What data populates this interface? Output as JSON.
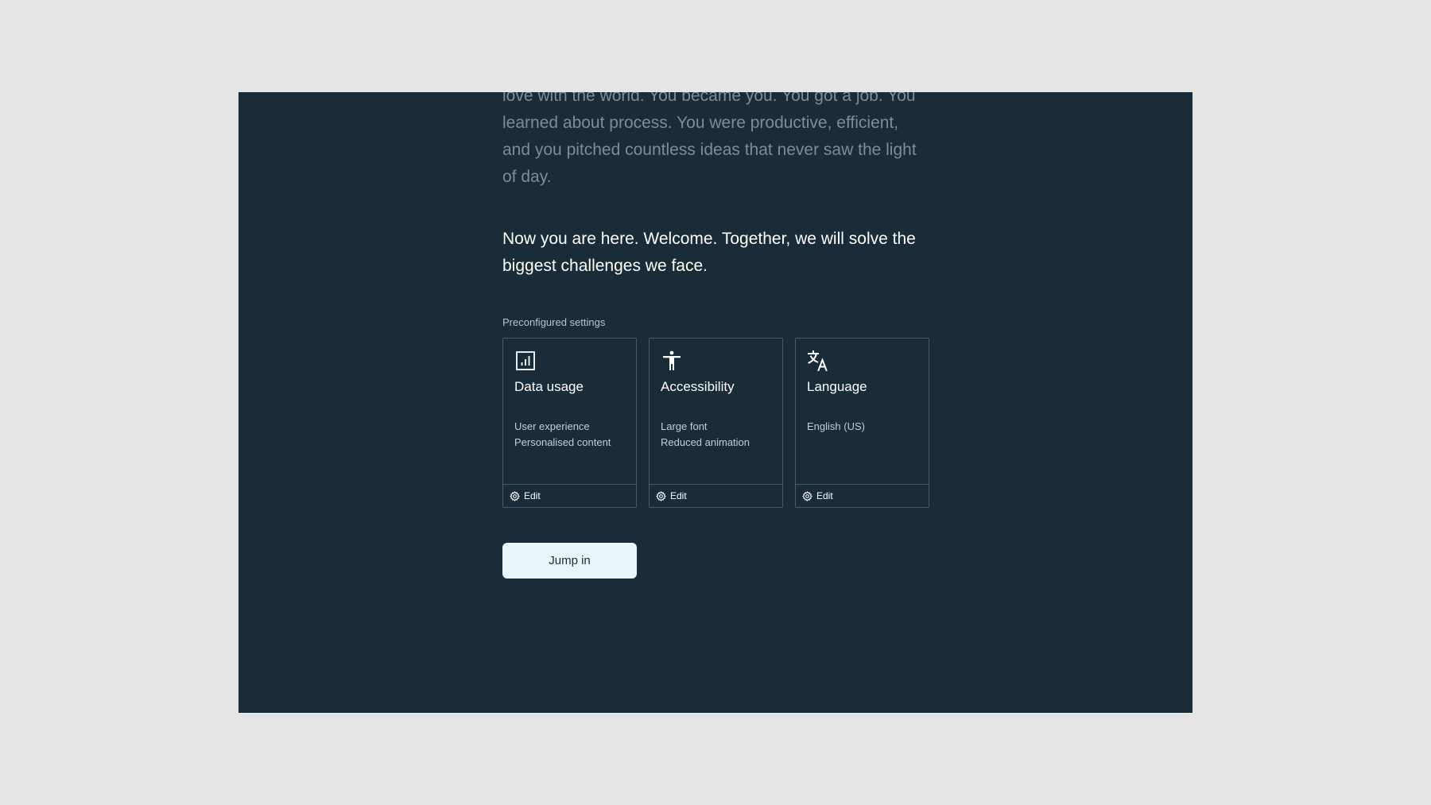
{
  "intro": {
    "text": "love with the world. You became you. You got a job. You learned about process. You were productive, efficient, and you pitched countless ideas that never saw the light of day."
  },
  "welcome": {
    "text": "Now you are here. Welcome. Together, we will solve the biggest challenges we face."
  },
  "settings": {
    "label": "Preconfigured settings",
    "cards": [
      {
        "icon": "chart-icon",
        "title": "Data usage",
        "details": [
          "User experience",
          "Personalised content"
        ],
        "edit_label": "Edit"
      },
      {
        "icon": "accessibility-icon",
        "title": "Accessibility",
        "details": [
          "Large font",
          "Reduced animation"
        ],
        "edit_label": "Edit"
      },
      {
        "icon": "translate-icon",
        "title": "Language",
        "details": [
          "English (US)"
        ],
        "edit_label": "Edit"
      }
    ]
  },
  "cta": {
    "label": "Jump in"
  },
  "colors": {
    "background": "#e5e5e5",
    "panel": "#1a2c38",
    "card_border": "#4a5a66",
    "button": "#eaf4fb"
  }
}
